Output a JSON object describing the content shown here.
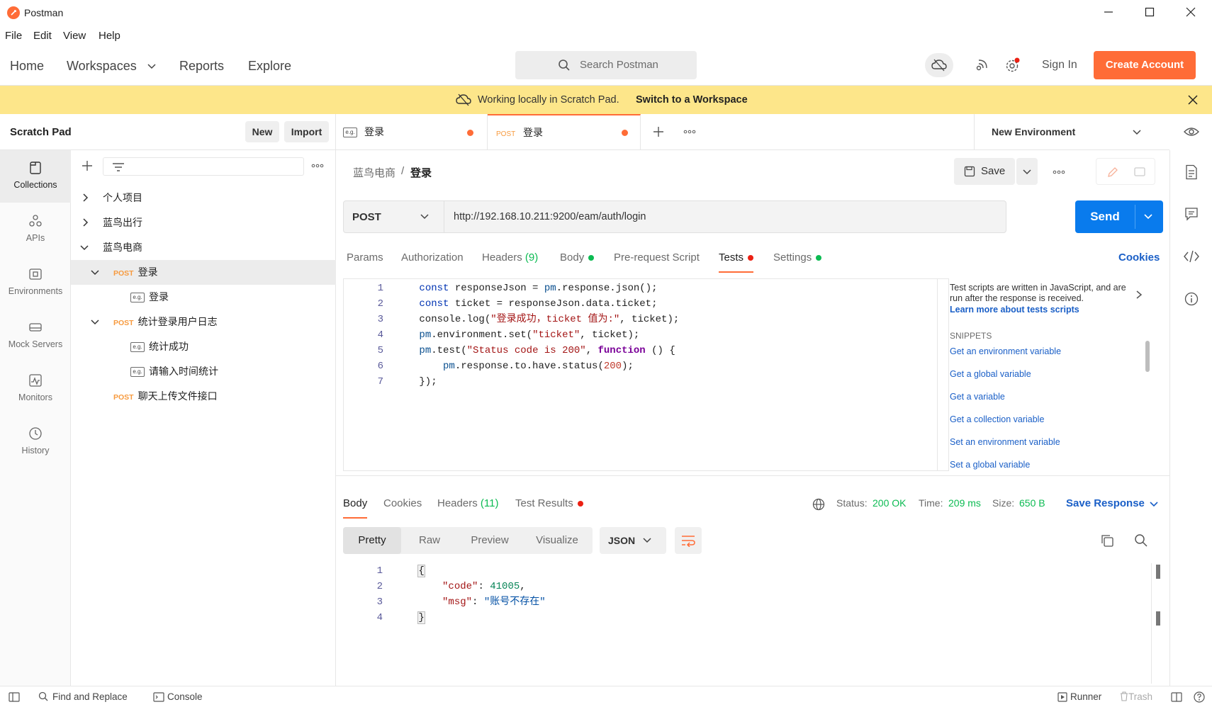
{
  "window": {
    "title": "Postman"
  },
  "menu": [
    "File",
    "Edit",
    "View",
    "Help"
  ],
  "header": {
    "nav": {
      "home": "Home",
      "workspaces": "Workspaces",
      "reports": "Reports",
      "explore": "Explore"
    },
    "search_placeholder": "Search Postman",
    "sign_in": "Sign In",
    "create_account": "Create Account"
  },
  "banner": {
    "text": "Working locally in Scratch Pad.",
    "link": "Switch to a Workspace"
  },
  "sidebar": {
    "title": "Scratch Pad",
    "new_label": "New",
    "import_label": "Import",
    "nav": [
      {
        "label": "Collections",
        "icon": "collections-icon"
      },
      {
        "label": "APIs",
        "icon": "apis-icon"
      },
      {
        "label": "Environments",
        "icon": "environments-icon"
      },
      {
        "label": "Mock Servers",
        "icon": "mock-servers-icon"
      },
      {
        "label": "Monitors",
        "icon": "monitors-icon"
      },
      {
        "label": "History",
        "icon": "history-icon"
      }
    ],
    "tree": [
      {
        "label": "个人项目"
      },
      {
        "label": "蓝鸟出行"
      },
      {
        "label": "蓝鸟电商"
      },
      {
        "method": "POST",
        "label": "登录"
      },
      {
        "label": "登录"
      },
      {
        "method": "POST",
        "label": "统计登录用户日志"
      },
      {
        "label": "统计成功"
      },
      {
        "label": "请输入时间统计"
      },
      {
        "method": "POST",
        "label": "聊天上传文件接口"
      }
    ]
  },
  "tabs": [
    {
      "label": "登录",
      "unsaved": true
    },
    {
      "method": "POST",
      "label": "登录",
      "unsaved": true
    }
  ],
  "environment": {
    "selected": "New Environment"
  },
  "request": {
    "breadcrumb_parent": "蓝鸟电商",
    "breadcrumb_current": "登录",
    "save_label": "Save",
    "method": "POST",
    "url": "http://192.168.10.211:9200/eam/auth/login",
    "send_label": "Send",
    "tabs": {
      "params": "Params",
      "authorization": "Authorization",
      "headers": "Headers",
      "headers_count": "(9)",
      "body": "Body",
      "pre_request": "Pre-request Script",
      "tests": "Tests",
      "settings": "Settings"
    },
    "cookies_label": "Cookies",
    "code_line_numbers": [
      "1",
      "2",
      "3",
      "4",
      "5",
      "6",
      "7"
    ]
  },
  "snippets_panel": {
    "intro": "Test scripts are written in JavaScript, and are run after the response is received.",
    "learn_more": "Learn more about tests scripts",
    "heading": "SNIPPETS",
    "items": [
      "Get an environment variable",
      "Get a global variable",
      "Get a variable",
      "Get a collection variable",
      "Set an environment variable",
      "Set a global variable"
    ]
  },
  "response": {
    "tabs": {
      "body": "Body",
      "cookies": "Cookies",
      "headers": "Headers",
      "headers_count": "(11)",
      "test_results": "Test Results"
    },
    "status_label": "Status:",
    "status_value": "200 OK",
    "time_label": "Time:",
    "time_value": "209 ms",
    "size_label": "Size:",
    "size_value": "650 B",
    "save_response": "Save Response",
    "view_modes": [
      "Pretty",
      "Raw",
      "Preview",
      "Visualize"
    ],
    "format": "JSON",
    "line_numbers": [
      "1",
      "2",
      "3",
      "4"
    ]
  },
  "statusbar": {
    "find_replace": "Find and Replace",
    "console": "Console",
    "runner": "Runner",
    "trash": "Trash"
  },
  "colors": {
    "accent": "#ff6c37",
    "send": "#097bed",
    "banner": "#fde68a",
    "success": "#0cbb52",
    "link": "#1a5fc7"
  }
}
